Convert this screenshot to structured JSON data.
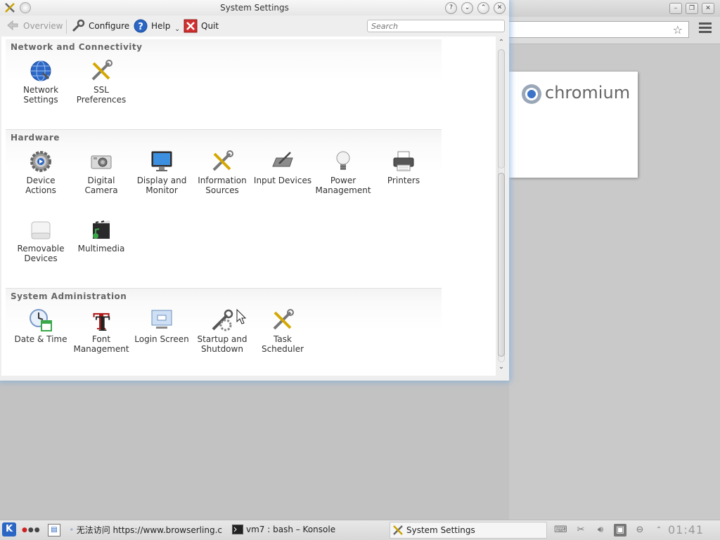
{
  "window": {
    "title": "System Settings",
    "toolbar": {
      "overview": "Overview",
      "configure": "Configure",
      "help": "Help",
      "quit": "Quit",
      "search_placeholder": "Search"
    }
  },
  "categories": [
    {
      "title": "Network and Connectivity",
      "items": [
        {
          "label": "Network Settings",
          "icon": "network-globe-icon"
        },
        {
          "label": "SSL Preferences",
          "icon": "ssl-tools-icon"
        }
      ]
    },
    {
      "title": "Hardware",
      "items": [
        {
          "label": "Device Actions",
          "icon": "device-actions-gear-icon"
        },
        {
          "label": "Digital Camera",
          "icon": "camera-icon"
        },
        {
          "label": "Display and Monitor",
          "icon": "monitor-icon"
        },
        {
          "label": "Information Sources",
          "icon": "info-tools-icon"
        },
        {
          "label": "Input Devices",
          "icon": "tablet-pen-icon"
        },
        {
          "label": "Power Management",
          "icon": "lightbulb-icon"
        },
        {
          "label": "Printers",
          "icon": "printer-icon"
        },
        {
          "label": "Removable Devices",
          "icon": "removable-drive-icon"
        },
        {
          "label": "Multimedia",
          "icon": "clapperboard-icon"
        }
      ]
    },
    {
      "title": "System Administration",
      "items": [
        {
          "label": "Date & Time",
          "icon": "clock-calendar-icon"
        },
        {
          "label": "Font Management",
          "icon": "font-t-icon"
        },
        {
          "label": "Login Screen",
          "icon": "login-screen-icon"
        },
        {
          "label": "Startup and Shutdown",
          "icon": "startup-gear-icon"
        },
        {
          "label": "Task Scheduler",
          "icon": "task-tools-icon"
        }
      ]
    }
  ],
  "chromium": {
    "brand": "chromium"
  },
  "taskbar": {
    "tasks": [
      {
        "label": "无法访问 https://www.browserling.c",
        "icon": "chromium-icon"
      },
      {
        "label": "vm7 : bash – Konsole",
        "icon": "terminal-icon"
      },
      {
        "label": "System Settings",
        "icon": "tools-icon"
      }
    ],
    "clock": "01:41"
  }
}
